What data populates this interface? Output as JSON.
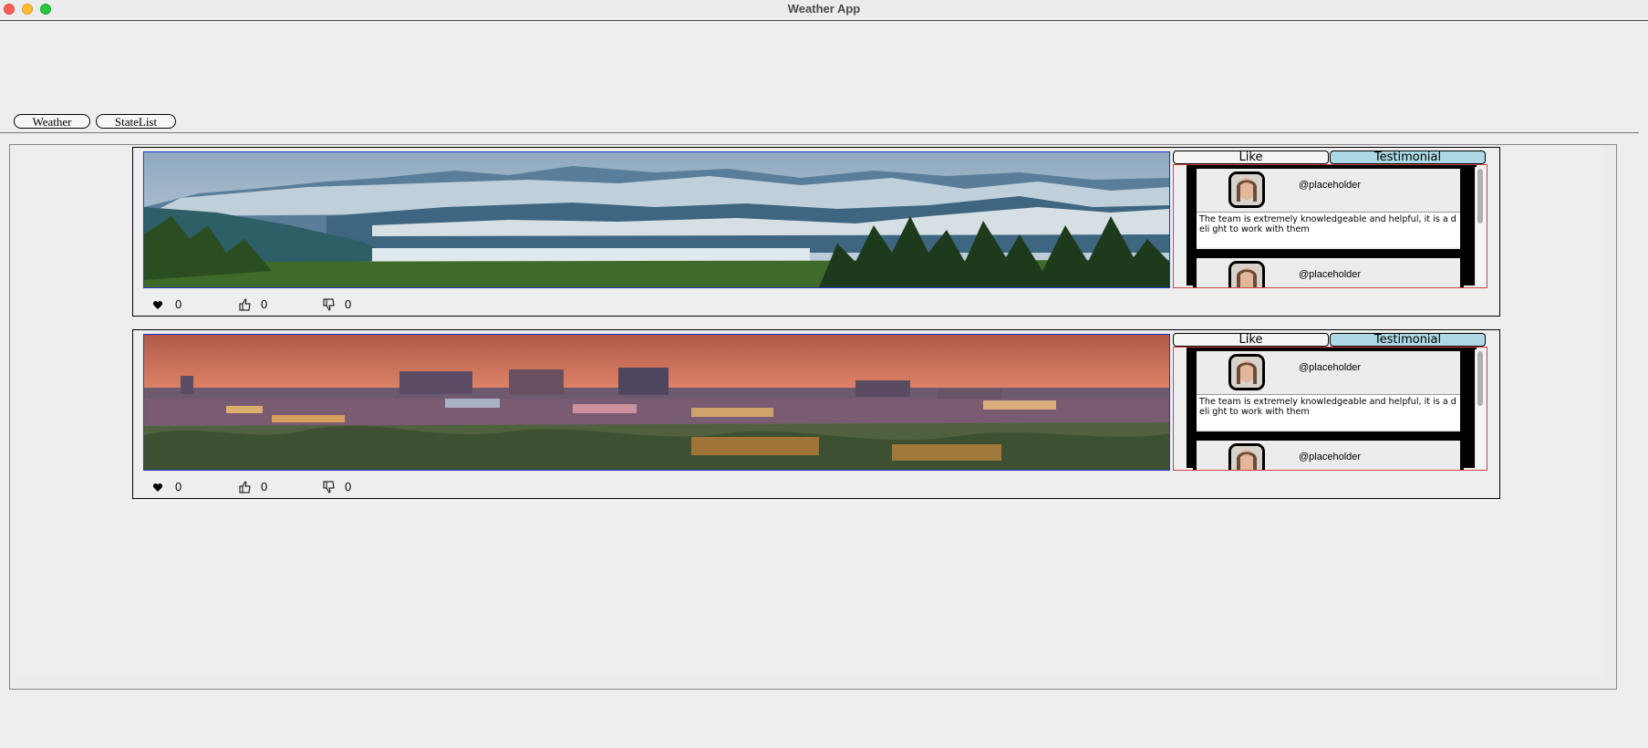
{
  "window": {
    "title": "Weather App"
  },
  "nav": {
    "weather_label": "Weather",
    "statelist_label": "StateList"
  },
  "cards": [
    {
      "scene": "mountains",
      "stats": {
        "hearts": "0",
        "likes": "0",
        "dislikes": "0"
      },
      "tabs": {
        "like": "Like",
        "testimonial": "Testimonial"
      },
      "testimonials": [
        {
          "handle": "@placeholder",
          "text": "The team is extremely knowledgeable and helpful, it is a deli ght to work with them"
        },
        {
          "handle": "@placeholder"
        }
      ]
    },
    {
      "scene": "city-sunset",
      "stats": {
        "hearts": "0",
        "likes": "0",
        "dislikes": "0"
      },
      "tabs": {
        "like": "Like",
        "testimonial": "Testimonial"
      },
      "testimonials": [
        {
          "handle": "@placeholder",
          "text": "The team is extremely knowledgeable and helpful, it is a deli ght to work with them"
        },
        {
          "handle": "@placeholder"
        }
      ]
    }
  ],
  "colors": {
    "active_tab": "#add8e6",
    "photo_border": "#2233cc",
    "scroll_border": "#d04545"
  },
  "icons": [
    "heart-icon",
    "thumbs-up-icon",
    "thumbs-down-icon"
  ]
}
